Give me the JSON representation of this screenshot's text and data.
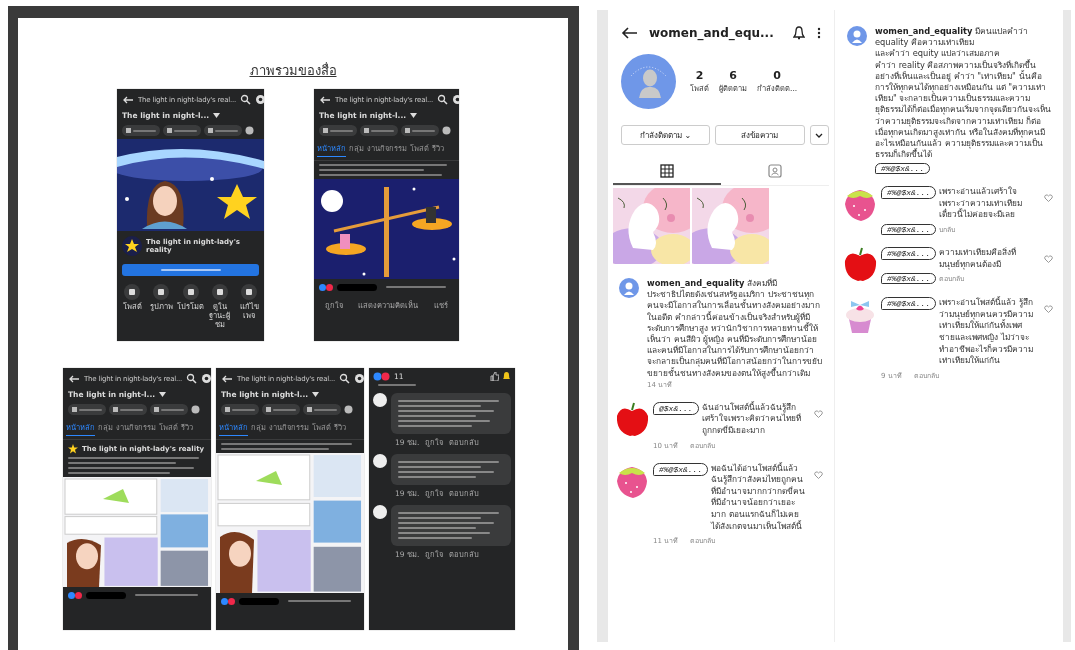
{
  "document": {
    "title": "ภาพรวมของสื่อ",
    "screenshots": [
      {
        "kind": "page_home",
        "header_title": "The light in night-lady's real...",
        "page_name": "The light in night-l...",
        "name": "The light in night-lady's reality",
        "actions": [
          "โพสต์",
          "รูปภาพ",
          "โปรโมต",
          "ดูในฐานะผู้ชม",
          "แก้ไขเพจ"
        ]
      },
      {
        "kind": "post",
        "picture": {
          "kind": "scale"
        },
        "header_title": "The light in night-lady's real...",
        "page_name": "The light in night-l...",
        "tabs": [
          {
            "label": "หน้าหลัก",
            "selected": true
          },
          {
            "label": "กลุ่ม",
            "selected": false
          },
          {
            "label": "งานกิจกรรม",
            "selected": false
          },
          {
            "label": "โพสต์",
            "selected": false
          },
          {
            "label": "รีวิว",
            "selected": false
          }
        ],
        "footer": [
          "ถูกใจ",
          "แสดงความคิดเห็น",
          "แชร์"
        ]
      },
      {
        "kind": "post",
        "picture": {
          "kind": "comic"
        },
        "header_title": "The light in night-lady's real...",
        "page_name": "The light in night-l...",
        "tabs": [
          {
            "label": "หน้าหลัก",
            "selected": true
          },
          {
            "label": "กลุ่ม",
            "selected": false
          },
          {
            "label": "งานกิจกรรม",
            "selected": false
          },
          {
            "label": "โพสต์",
            "selected": false
          },
          {
            "label": "รีวิว",
            "selected": false
          }
        ],
        "author": "The light in night-lady's reality"
      },
      {
        "kind": "post",
        "picture": {
          "kind": "comic"
        },
        "header_title": "The light in night-lady's real...",
        "page_name": "The light in night-l...",
        "tabs": [
          {
            "label": "หน้าหลัก",
            "selected": true
          },
          {
            "label": "กลุ่ม",
            "selected": false
          },
          {
            "label": "งานกิจกรรม",
            "selected": false
          },
          {
            "label": "โพสต์",
            "selected": false
          },
          {
            "label": "รีวิว",
            "selected": false
          }
        ]
      },
      {
        "kind": "comments",
        "count": "11",
        "comments": [
          {
            "meta": [
              "19 ชม.",
              "ถูกใจ",
              "ตอบกลับ"
            ]
          },
          {
            "meta": [
              "19 ชม.",
              "ถูกใจ",
              "ตอบกลับ"
            ]
          },
          {
            "meta": [
              "19 ชม.",
              "ถูกใจ",
              "ตอบกลับ"
            ]
          }
        ]
      }
    ]
  },
  "instagram": {
    "username": "women_and_equ...",
    "stats": [
      {
        "value": "2",
        "label": "โพสต์"
      },
      {
        "value": "6",
        "label": "ผู้ติดตาม"
      },
      {
        "value": "0",
        "label": "กำลังติดต..."
      }
    ],
    "buttons": [
      "กำลังติดตาม ⌄",
      "ส่งข้อความ"
    ],
    "tabs": [
      {
        "kind": "grid",
        "selected": true
      },
      {
        "kind": "tagged",
        "selected": false
      }
    ],
    "posts": [
      {
        "kind": "picture"
      },
      {
        "kind": "picture"
      }
    ]
  },
  "post_comments": [
    {
      "caption": {
        "user": "women_and_equality",
        "text": "สังคมที่มีประชาธิปไตยดังเช่นสหรัฐอเมริกา ประชาชนทุกคนจะมีโอกาสในการเลื่อนชั้นทางสังคมอย่างมาก ในอดีต คำกล่าวนี้ค่อนข้างเป็นจริงสำหรับผู้ที่มีระดับการศึกษาสูง หว่านักวิชาการหลายท่านชี้ให้เห็นว่า คนสีผิว ผู้หญิง คนที่มีระดับการศึกษาน้อย และคนที่มีโอกาสในการได้รับการศึกษาน้อยกว่า จะกลายเป็นกลุ่มคนที่มีโอกาสน้อยกว่าในการขยับขยายชั้นชนทางสังคมของตนให้สูงขึ้นกว่าเดิม",
        "time": "14 นาที"
      },
      "comments": [
        {
          "avatar": {
            "kind": "apple"
          },
          "name": "@$x&...",
          "text": "ฉันอ่านโพสต์นี้แล้วฉันรู้สึกเศร้าใจเพราะคิดว่าคนไทยที่ถูกกดขี่มีเยอะมาก",
          "time": "10 นาที",
          "reply": "ตอบกลับ"
        },
        {
          "avatar": {
            "kind": "strawberry"
          },
          "name": "#%@$x&...",
          "text": "พอฉันได้อ่านโพสต์นี้แล้ว ฉันรู้สึกว่าสังคมไทยถูกคนที่มีอำนาจมากกว่ากดขี่คนที่มีอำนาจน้อยกว่าเยอะมาก ตอนแรกฉันก็ไม่เคยได้สังเกตจนมาเห็นโพสต์นี้",
          "time": "11 นาที",
          "reply": "ตอบกลับ"
        }
      ]
    },
    {
      "caption": {
        "user": "women_and_equality",
        "text": "มีคนแปลคำว่า equality คือความเท่าเทียม\nและคำว่า equity แปลว่าเสมอภาค\nคำว่า reality คือสภาพความเป็นจริงที่เกิดขึ้นอย่างที่เห็นและเป็นอยู่ คำว่า \"เท่าเทียม\" นั้นคือการให้ทุกคนได้ทุกอย่างเหมือนกัน แต่ \"ความเท่าเทียม\" จะกลายเป็นความเป็นธรรมและความยุติธรรมได้ก็ต่อเมื่อทุกคนเริ่มจากจุดเดียวกันจะเห็นว่าความยุติธรรมจะเกิดจากความเท่าเทียม ก็ต่อเมื่อทุกคนเกิดมาสูงเท่ากัน หรือในสังคมที่ทุกคนมีอะไรเหมือนกันแล้ว ความยุติธรรมและความเป็นธรรมก็เกิดขึ้นได้",
        "time_name": "#%@$x&..."
      },
      "comments": [
        {
          "avatar": {
            "kind": "strawberry"
          },
          "name": "#%@$x&...",
          "text": "เพราะอ่านแล้วเศร้าใจเพราะว่าความเท่าเทียมเดี๋ยวนี้ไม่ค่อยจะมีเลย",
          "time_name": "#%@$x&...",
          "reply": "บกลับ"
        },
        {
          "avatar": {
            "kind": "apple"
          },
          "name": "#%@$x&...",
          "text": "ความเท่าเทียมคือสิ่งที่มนุษย์ทุกคนต้องมี",
          "time_name": "#%@$x&...",
          "reply": "ตอบกลับ"
        },
        {
          "avatar": {
            "kind": "cupcake"
          },
          "name": "#%@$x&...",
          "text": "เพราะอ่านโพสต์นี้แล้ว รู้สึกว่ามนุษย์ทุกคนควรมีความเท่าเทียมให้แก่กันทั้งเพศชายและเพศหญิง ไม่ว่าจะทำอาชีพอะไรก็ควรมีความเท่าเทียมให้แก่กัน",
          "time": "9 นาที",
          "reply": "ตอบกลับ"
        }
      ]
    }
  ]
}
